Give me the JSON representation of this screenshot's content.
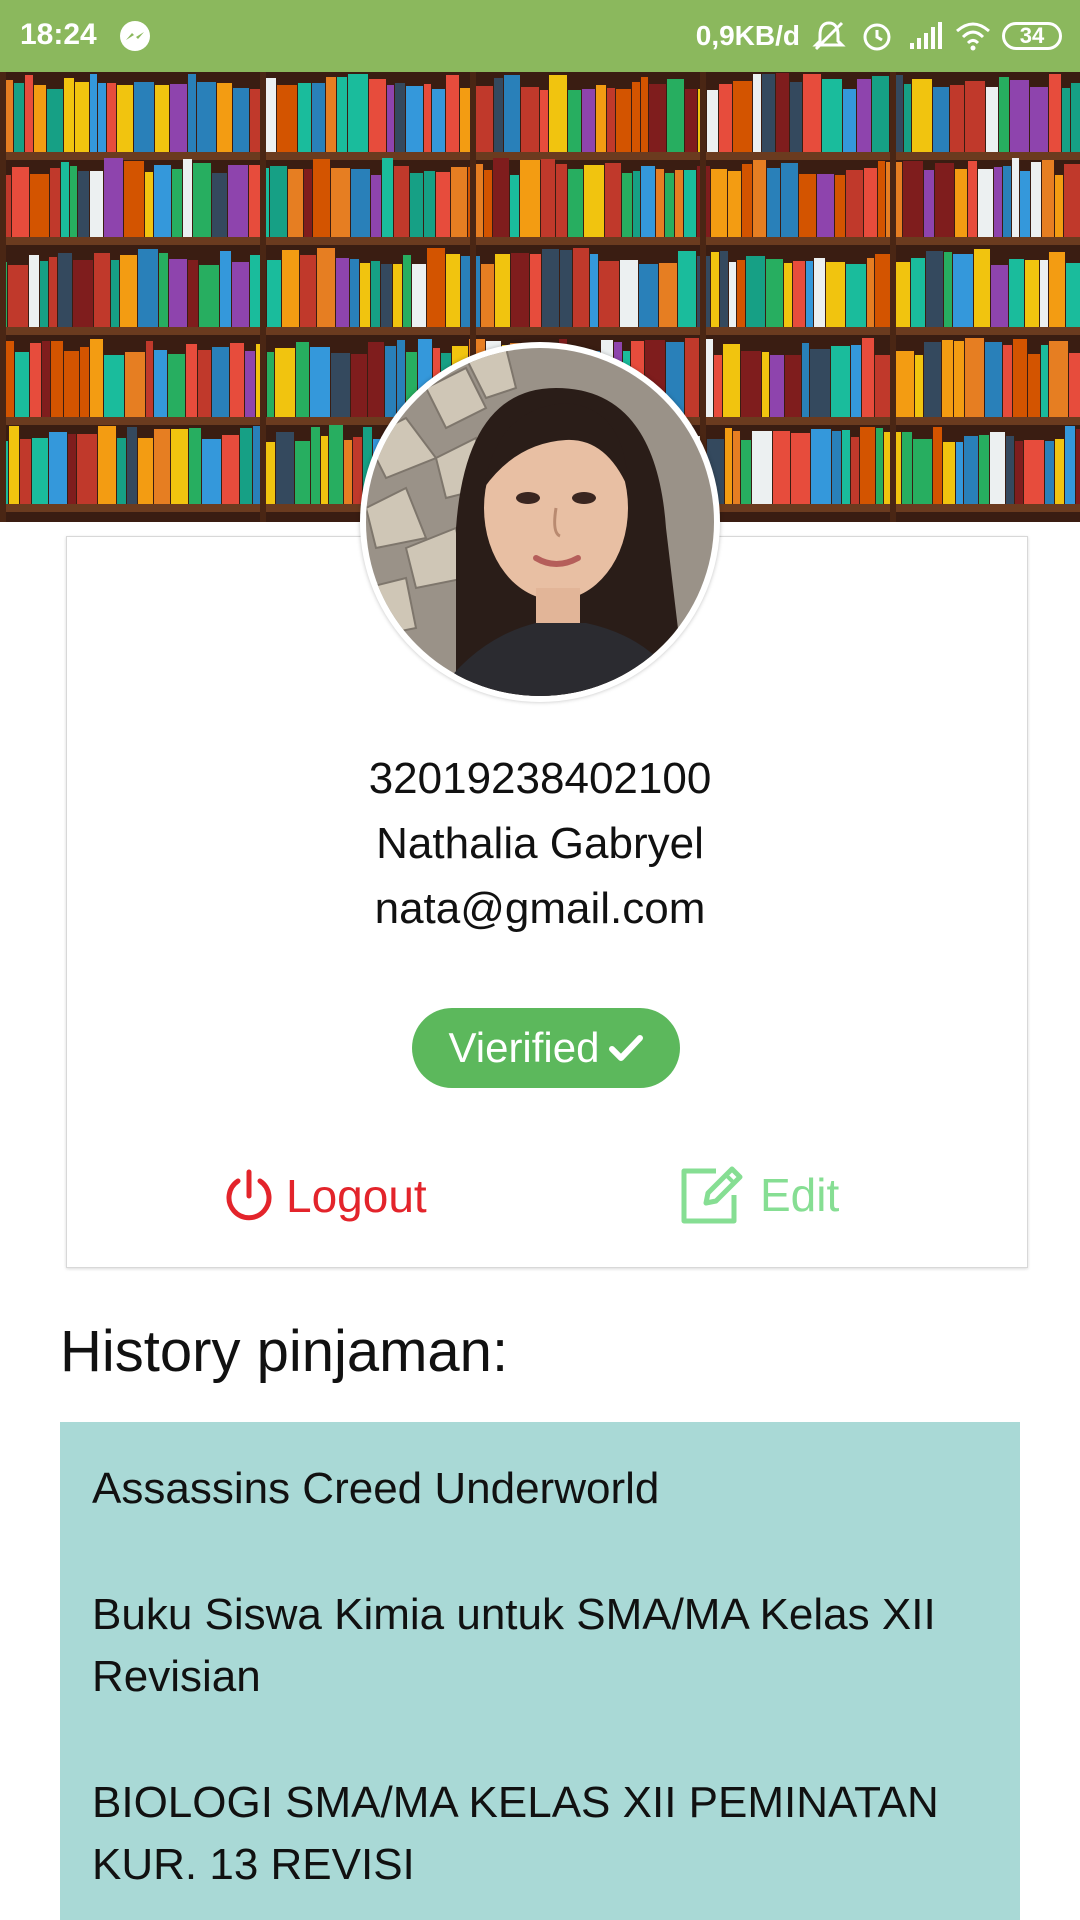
{
  "status_bar": {
    "time": "18:24",
    "network_speed": "0,9KB/d",
    "battery": "34",
    "icons": [
      "messenger-icon",
      "mute-bell-icon",
      "alarm-icon",
      "signal-icon",
      "wifi-icon",
      "battery-icon"
    ]
  },
  "profile": {
    "id_number": "32019238402100",
    "name": "Nathalia Gabryel",
    "email": "nata@gmail.com",
    "badge_label": "Vierified",
    "badge_icon": "check-icon"
  },
  "actions": {
    "logout_label": "Logout",
    "edit_label": "Edit"
  },
  "history": {
    "title": "History pinjaman:",
    "items": [
      "Assassins Creed Underworld",
      "Buku Siswa Kimia untuk SMA/MA Kelas XII Revisian",
      "BIOLOGI SMA/MA KELAS XII PEMINATAN KUR. 13 REVISI"
    ]
  },
  "colors": {
    "status_bar": "#8bb85d",
    "badge": "#5cb85c",
    "logout": "#e3242b",
    "edit": "#86de93",
    "history_bg": "#a9d9d6"
  }
}
